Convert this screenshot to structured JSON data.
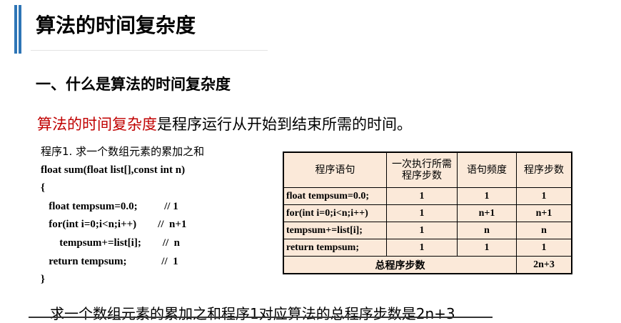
{
  "title": "算法的时间复杂度",
  "section": "一、什么是算法的时间复杂度",
  "definition": {
    "term": "算法的时间复杂度",
    "rest": "是程序运行从开始到结束所需的时间。"
  },
  "code": {
    "caption": "程序1. 求一个数组元素的累加之和",
    "lines": [
      "float sum(float list[],const int n)",
      "{",
      "   float tempsum=0.0;          // 1",
      "   for(int i=0;i<n;i++)        //  n+1",
      "       tempsum+=list[i];        //  n",
      "   return tempsum;             //  1",
      "}"
    ]
  },
  "table": {
    "headers": [
      "程序语句",
      "一次执行所需程序步数",
      "语句频度",
      "程序步数"
    ],
    "rows": [
      [
        "float tempsum=0.0;",
        "1",
        "1",
        "1"
      ],
      [
        "for(int i=0;i<n;i++)",
        "1",
        "n+1",
        "n+1"
      ],
      [
        "tempsum+=list[i];",
        "1",
        "n",
        "n"
      ],
      [
        "return tempsum;",
        "1",
        "1",
        "1"
      ]
    ],
    "total_label": "总程序步数",
    "total_value": "2n+3"
  },
  "conclusion": "求一个数组元素的累加之和程序1对应算法的总程序步数是2n+3"
}
